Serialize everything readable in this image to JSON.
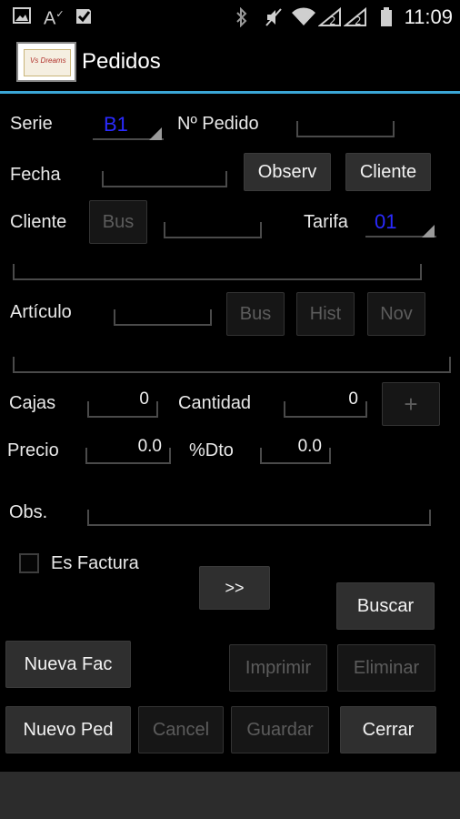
{
  "status_bar": {
    "time": "11:09",
    "icons": [
      "image-icon",
      "text-icon",
      "checkbox-icon",
      "bluetooth-icon",
      "mute-icon",
      "wifi-icon",
      "signal-icon",
      "signal-2-icon",
      "battery-icon"
    ]
  },
  "action_bar": {
    "title": "Pedidos",
    "logo_text": "Vs Dreams"
  },
  "form": {
    "serie_label": "Serie",
    "serie_value": "B1",
    "pedido_label": "Nº Pedido",
    "pedido_value": "",
    "fecha_label": "Fecha",
    "fecha_value": "",
    "observ_button": "Observ",
    "cliente_button": "Cliente",
    "cliente_label": "Cliente",
    "bus_button": "Bus",
    "cliente_value": "",
    "tarifa_label": "Tarifa",
    "tarifa_value": "01",
    "articulo_label": "Artículo",
    "articulo_value": "",
    "art_bus_button": "Bus",
    "hist_button": "Hist",
    "nov_button": "Nov",
    "cajas_label": "Cajas",
    "cajas_value": "0",
    "cantidad_label": "Cantidad",
    "cantidad_value": "0",
    "plus_button": "+",
    "precio_label": "Precio",
    "precio_value": "0.0",
    "dto_label": "%Dto",
    "dto_value": "0.0",
    "obs_label": "Obs.",
    "obs_value": "",
    "es_factura_label": "Es Factura",
    "es_factura_checked": false,
    "next_button": ">>"
  },
  "actions": {
    "buscar": "Buscar",
    "nueva_fac": "Nueva Fac",
    "imprimir": "Imprimir",
    "eliminar": "Eliminar",
    "nuevo_ped": "Nuevo Ped",
    "cancel": "Cancel",
    "guardar": "Guardar",
    "cerrar": "Cerrar"
  },
  "colors": {
    "accent": "#3aa6d6",
    "spinner_value": "#2a2aff"
  }
}
